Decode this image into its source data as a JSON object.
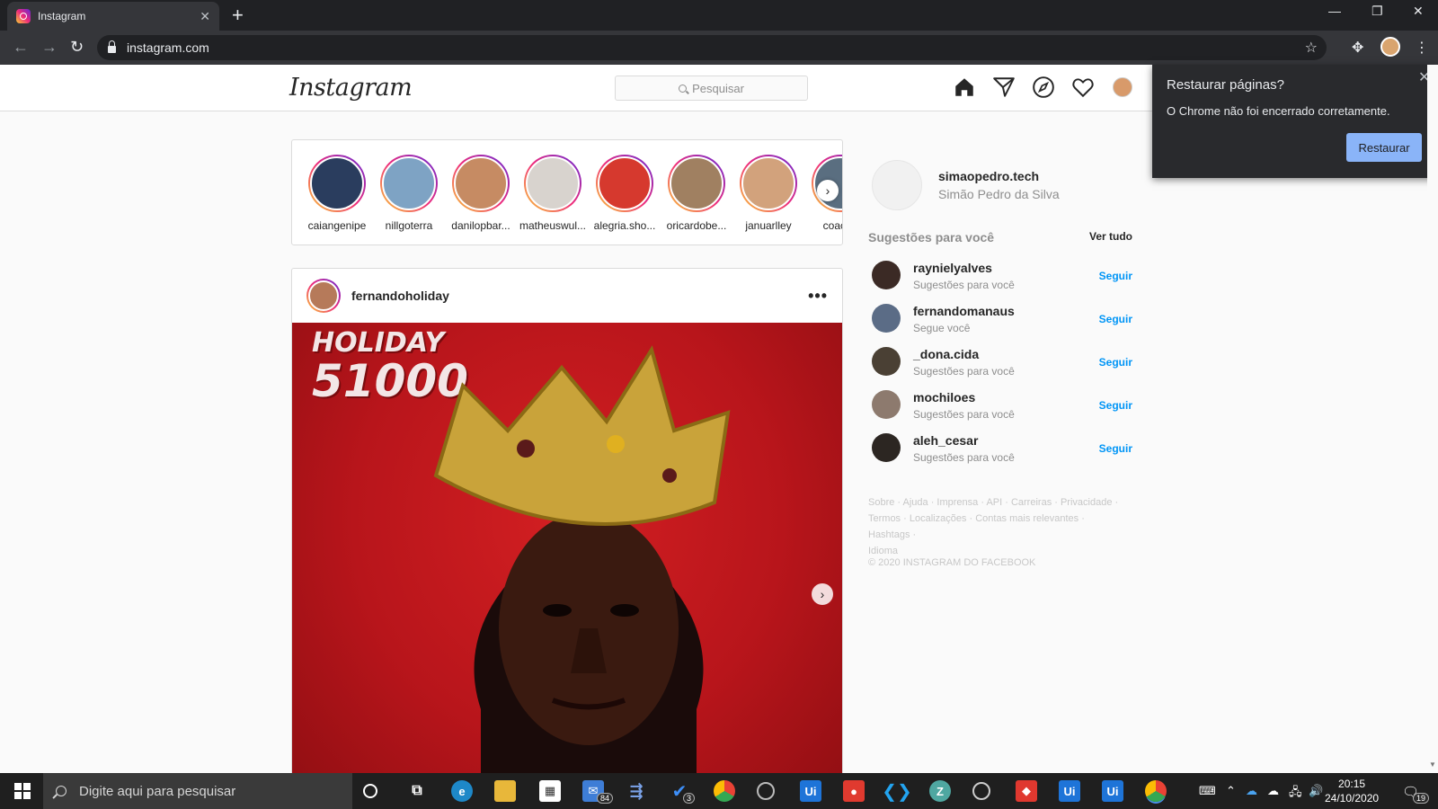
{
  "browser": {
    "tab_title": "Instagram",
    "tab_close": "✕",
    "new_tab": "+",
    "url": "instagram.com",
    "window_min": "—",
    "window_restore": "❐",
    "window_close": "✕"
  },
  "instagram": {
    "logo": "Instagram",
    "search_placeholder": "Pesquisar"
  },
  "stories": [
    {
      "name": "caiangenipe"
    },
    {
      "name": "nillgoterra"
    },
    {
      "name": "danilopbar..."
    },
    {
      "name": "matheuswul..."
    },
    {
      "name": "alegria.sho..."
    },
    {
      "name": "oricardobe..."
    },
    {
      "name": "januarlley"
    },
    {
      "name": "coacha"
    }
  ],
  "post": {
    "username": "fernandoholiday",
    "more": "•••",
    "image_line1": "HOLIDAY",
    "image_line2": "51000"
  },
  "sidebar": {
    "username": "simaopedro.tech",
    "fullname": "Simão Pedro da Silva",
    "suggestions_title": "Sugestões para você",
    "see_all": "Ver tudo",
    "suggestions": [
      {
        "username": "raynielyalves",
        "sub": "Sugestões para você",
        "action": "Seguir"
      },
      {
        "username": "fernandomanaus",
        "sub": "Segue você",
        "action": "Seguir"
      },
      {
        "username": "_dona.cida",
        "sub": "Sugestões para você",
        "action": "Seguir"
      },
      {
        "username": "mochiloes",
        "sub": "Sugestões para você",
        "action": "Seguir"
      },
      {
        "username": "aleh_cesar",
        "sub": "Sugestões para você",
        "action": "Seguir"
      }
    ],
    "footer_line1": "Sobre · Ajuda · Imprensa · API · Carreiras · Privacidade ·",
    "footer_line2": "Termos · Localizações · Contas mais relevantes · Hashtags ·",
    "footer_line3": "Idioma",
    "copyright": "© 2020 INSTAGRAM DO FACEBOOK"
  },
  "restore_popup": {
    "title": "Restaurar páginas?",
    "message": "O Chrome não foi encerrado corretamente.",
    "button": "Restaurar",
    "close": "✕"
  },
  "taskbar": {
    "search_placeholder": "Digite aqui para pesquisar",
    "mail_badge": "84",
    "todo_badge": "3",
    "ui1": "Ui",
    "ui2": "Ui",
    "ui3": "Ui",
    "time": "20:15",
    "date": "24/10/2020",
    "notif_count": "19"
  }
}
